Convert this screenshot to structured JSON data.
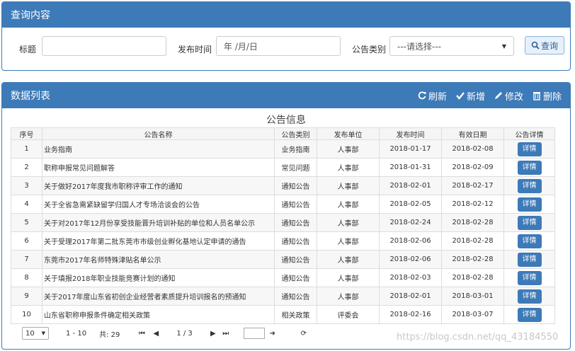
{
  "query": {
    "title": "查询内容",
    "label_title": "标题",
    "title_value": "",
    "label_date": "发布时间",
    "date_placeholder": "年 /月/日",
    "label_category": "公告类别",
    "category_selected": "---请选择---",
    "search_label": "查询"
  },
  "list": {
    "title": "数据列表",
    "refresh": "刷新",
    "add": "新增",
    "edit": "修改",
    "delete": "删除",
    "caption": "公告信息",
    "columns": [
      "序号",
      "公告名称",
      "公告类别",
      "发布单位",
      "发布时间",
      "有效日期",
      "公告详情"
    ],
    "rows": [
      {
        "no": "1",
        "name": "业务指南",
        "category": "业务指南",
        "unit": "人事部",
        "publish": "2018-01-17",
        "expire": "2018-02-08",
        "detail": "详情"
      },
      {
        "no": "2",
        "name": "职称申报常见问题解答",
        "category": "常见问题",
        "unit": "人事部",
        "publish": "2018-01-31",
        "expire": "2018-02-09",
        "detail": "详情"
      },
      {
        "no": "3",
        "name": "关于做好2017年度我市职称评审工作的通知",
        "category": "通知公告",
        "unit": "人事部",
        "publish": "2018-02-01",
        "expire": "2018-02-17",
        "detail": "详情"
      },
      {
        "no": "4",
        "name": "关于全省急需紧缺留学归国人才专场洽谈会的公告",
        "category": "通知公告",
        "unit": "人事部",
        "publish": "2018-02-05",
        "expire": "2018-02-12",
        "detail": "详情"
      },
      {
        "no": "5",
        "name": "关于对2017年12月份享受技能晋升培训补贴的单位和人员名单公示",
        "category": "通知公告",
        "unit": "人事部",
        "publish": "2018-02-24",
        "expire": "2018-02-28",
        "detail": "详情"
      },
      {
        "no": "6",
        "name": "关于受理2017年第二批东莞市市级创业孵化基地认定申请的通告",
        "category": "通知公告",
        "unit": "人事部",
        "publish": "2018-02-06",
        "expire": "2018-02-28",
        "detail": "详情"
      },
      {
        "no": "7",
        "name": "东莞市2017年名师特殊津贴名单公示",
        "category": "通知公告",
        "unit": "人事部",
        "publish": "2018-02-06",
        "expire": "2018-02-28",
        "detail": "详情"
      },
      {
        "no": "8",
        "name": "关于填报2018年职业技能竞赛计划的通知",
        "category": "通知公告",
        "unit": "人事部",
        "publish": "2018-02-03",
        "expire": "2018-02-28",
        "detail": "详情"
      },
      {
        "no": "9",
        "name": "关于2017年度山东省初创企业经营者素质提升培训报名的预通知",
        "category": "通知公告",
        "unit": "人事部",
        "publish": "2018-02-01",
        "expire": "2018-03-01",
        "detail": "详情"
      },
      {
        "no": "10",
        "name": "山东省职称申报条件确定相关政策",
        "category": "相关政策",
        "unit": "评委会",
        "publish": "2018-02-16",
        "expire": "2018-03-07",
        "detail": "详情"
      }
    ]
  },
  "pager": {
    "page_size": "10",
    "range": "1 - 10",
    "total": "共: 29",
    "page_info": "1 / 3",
    "first_icon": "first-page-icon",
    "prev_icon": "prev-page-icon",
    "next_icon": "next-page-icon",
    "last_icon": "last-page-icon",
    "go_icon": "go-arrow-icon",
    "refresh_icon": "refresh-icon"
  },
  "watermark": "https://blog.csdn.net/qq_43184550",
  "colors": {
    "primary": "#3d7ab8",
    "search_button_bg": "#e7f0fa"
  }
}
